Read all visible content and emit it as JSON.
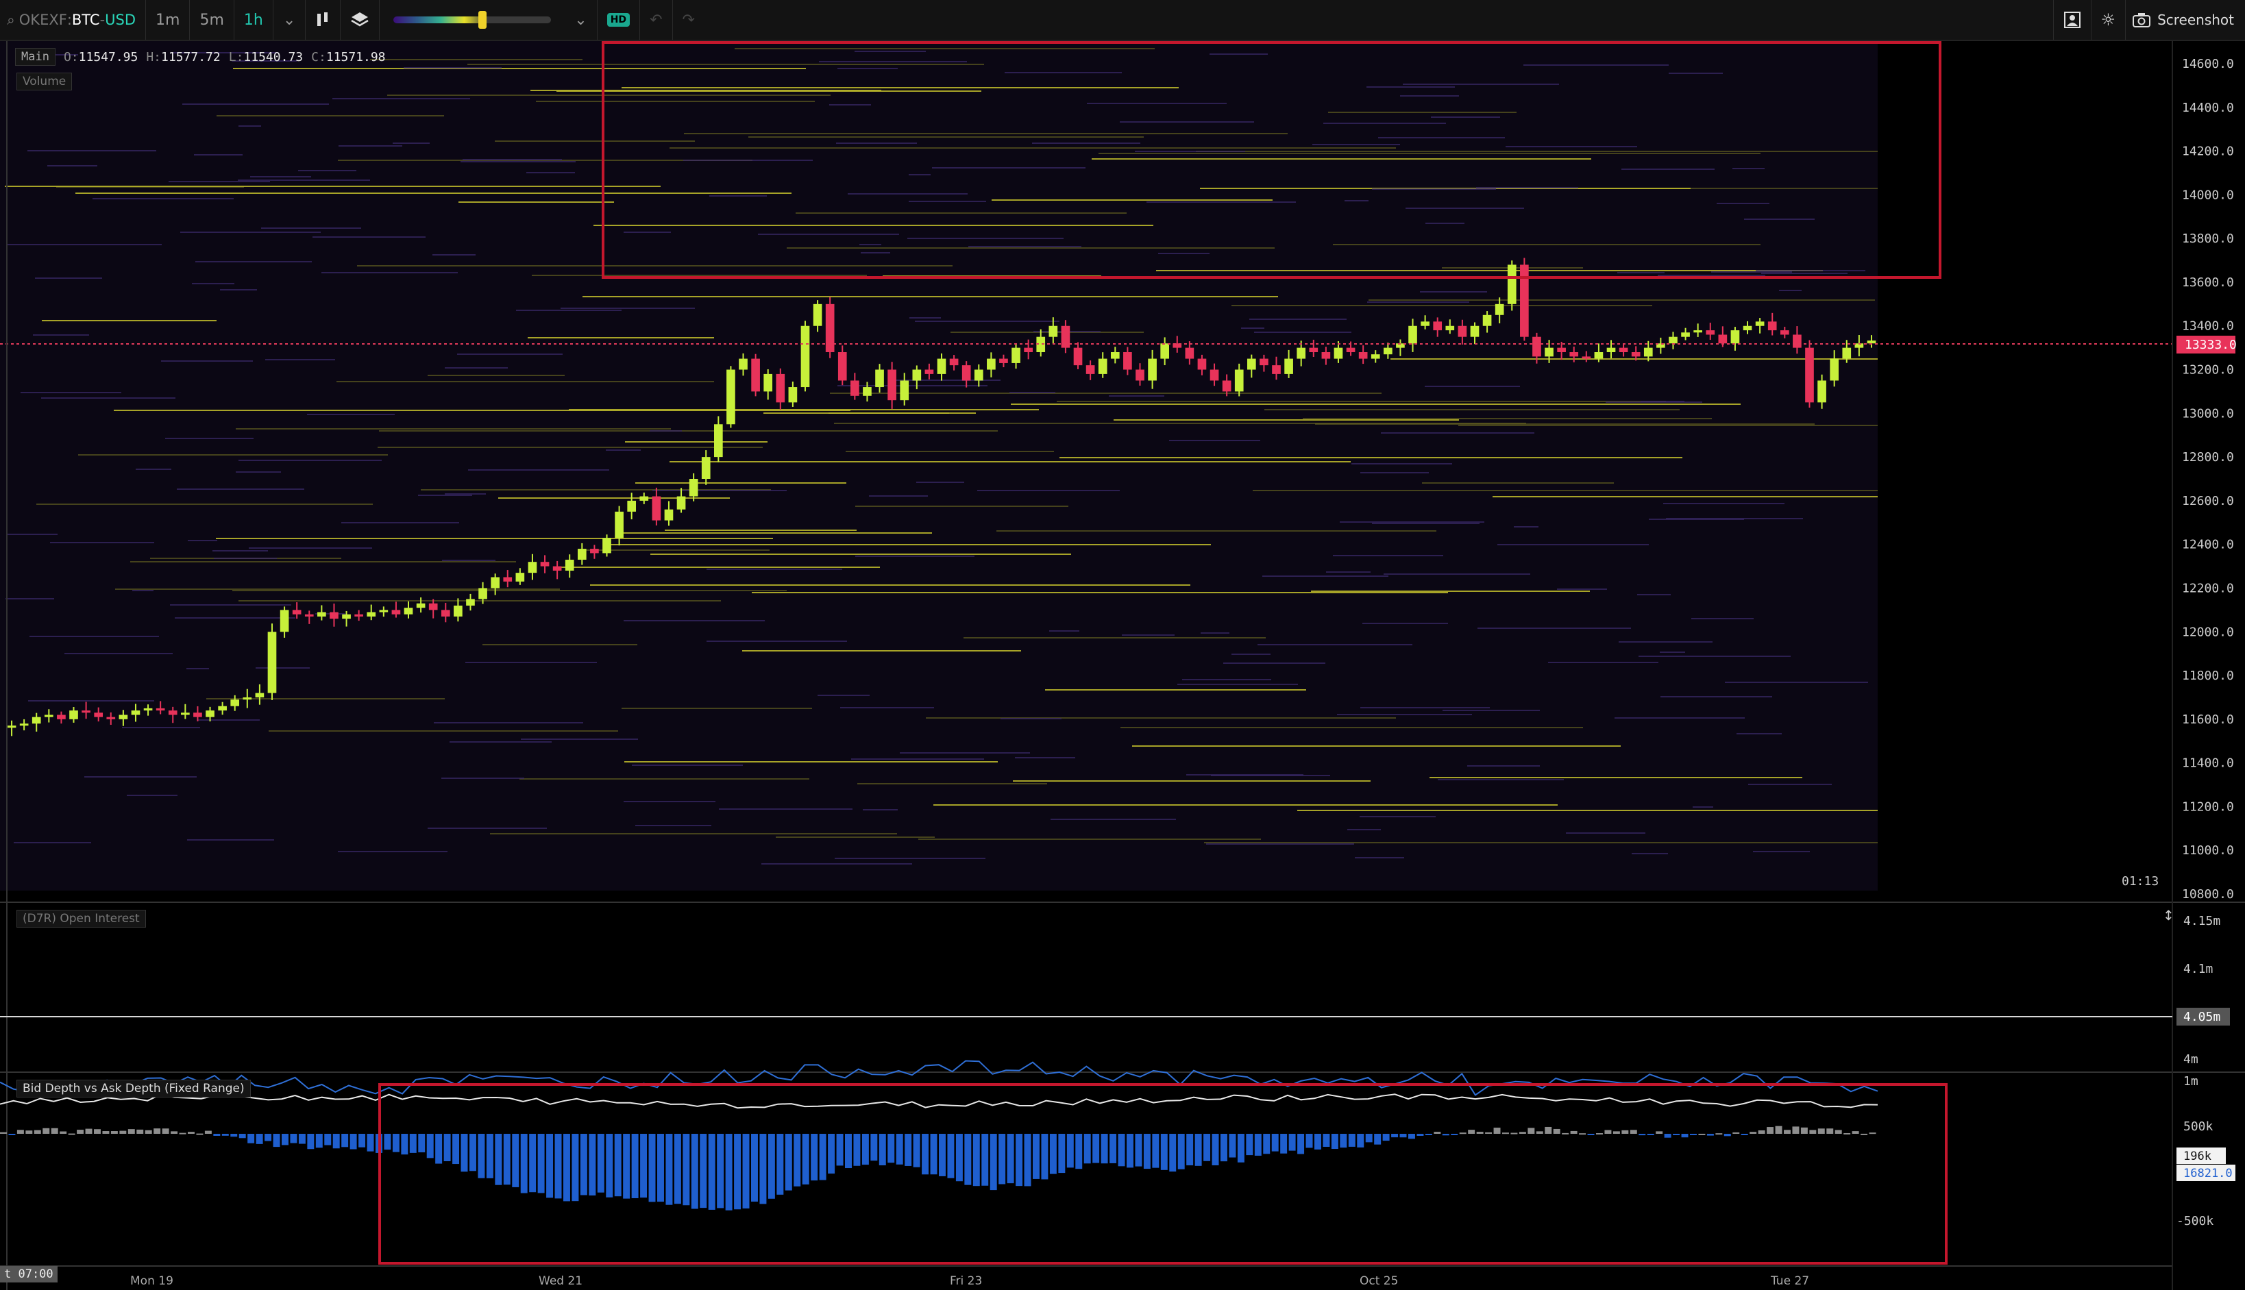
{
  "toolbar": {
    "exchange": "OKEXF",
    "pair": "BTC",
    "quote": "USD",
    "timeframes": [
      "1m",
      "5m",
      "1h"
    ],
    "active_timeframe": "1h",
    "hd_label": "HD",
    "screenshot_label": "Screenshot",
    "colors": {
      "accent": "#22c8b0",
      "heatmap_knob": "#f0d22a"
    }
  },
  "main_pane": {
    "tag": "Main",
    "open_label": "O:",
    "open": "11547.95",
    "high_label": "H:",
    "high": "11577.72",
    "low_label": "L:",
    "low": "11540.73",
    "close_label": "C:",
    "close": "11571.98",
    "volume_tag": "Volume",
    "timer": "01:13",
    "current_price": "13333.0",
    "price_axis": [
      "14600.0",
      "14400.0",
      "14200.0",
      "14000.0",
      "13800.0",
      "13600.0",
      "13400.0",
      "13200.0",
      "13000.0",
      "12800.0",
      "12600.0",
      "12400.0",
      "12200.0",
      "12000.0",
      "11800.0",
      "11600.0",
      "11400.0",
      "11200.0",
      "11000.0",
      "10800.0"
    ]
  },
  "oi_pane": {
    "title": "(D7R) Open Interest",
    "axis": [
      "4.15m",
      "4.1m",
      "4.05m",
      "4m"
    ],
    "current": "4.05m"
  },
  "depth_pane": {
    "title": "Bid Depth vs Ask Depth (Fixed Range)",
    "axis": [
      "1m",
      "500k",
      "-500k"
    ],
    "current_a": "196k",
    "current_b": "16821.0"
  },
  "time_axis": {
    "date_badge": "t 07:00",
    "labels": [
      "Mon 19",
      "Wed 21",
      "Fri 23",
      "Oct 25",
      "Tue 27"
    ]
  },
  "chart_data": {
    "type": "candlestick",
    "price_range": [
      10800,
      14700
    ],
    "candles_close": [
      11571,
      11580,
      11610,
      11620,
      11600,
      11640,
      11630,
      11610,
      11600,
      11620,
      11640,
      11650,
      11640,
      11620,
      11630,
      11610,
      11640,
      11660,
      11690,
      11700,
      11720,
      12000,
      12100,
      12080,
      12070,
      12090,
      12060,
      12080,
      12070,
      12090,
      12100,
      12080,
      12110,
      12130,
      12100,
      12070,
      12120,
      12150,
      12200,
      12250,
      12230,
      12270,
      12320,
      12300,
      12280,
      12330,
      12380,
      12360,
      12430,
      12550,
      12600,
      12620,
      12510,
      12560,
      12620,
      12700,
      12800,
      12950,
      13200,
      13250,
      13100,
      13180,
      13050,
      13120,
      13400,
      13500,
      13280,
      13150,
      13080,
      13120,
      13200,
      13060,
      13150,
      13200,
      13180,
      13250,
      13220,
      13150,
      13200,
      13250,
      13230,
      13300,
      13280,
      13350,
      13400,
      13300,
      13220,
      13180,
      13250,
      13280,
      13200,
      13150,
      13250,
      13320,
      13300,
      13250,
      13200,
      13150,
      13100,
      13200,
      13250,
      13220,
      13180,
      13250,
      13300,
      13280,
      13250,
      13300,
      13280,
      13250,
      13270,
      13300,
      13320,
      13400,
      13420,
      13380,
      13400,
      13350,
      13400,
      13450,
      13500,
      13680,
      13350,
      13260,
      13300,
      13280,
      13260,
      13250,
      13280,
      13300,
      13280,
      13260,
      13300,
      13320,
      13350,
      13370,
      13380,
      13360,
      13320,
      13380,
      13400,
      13420,
      13380,
      13360,
      13300,
      13050,
      13150,
      13250,
      13300,
      13320,
      13333
    ],
    "oi_series_level": "4.05m",
    "depth_delta_sample": [
      0.02,
      0.03,
      0.02,
      0.03,
      0.04,
      -0.05,
      -0.1,
      -0.12,
      -0.15,
      -0.2,
      -0.35,
      -0.5,
      -0.6,
      -0.55,
      -0.62,
      -0.7,
      -0.65,
      -0.5,
      -0.3,
      -0.25,
      -0.4,
      -0.5,
      -0.45,
      -0.3,
      -0.28,
      -0.32,
      -0.26,
      -0.2,
      -0.15,
      -0.1,
      -0.05,
      0.02,
      0.03,
      0.04,
      0.02,
      0.01,
      -0.02,
      0.0,
      0.05,
      0.02,
      0.03
    ]
  }
}
